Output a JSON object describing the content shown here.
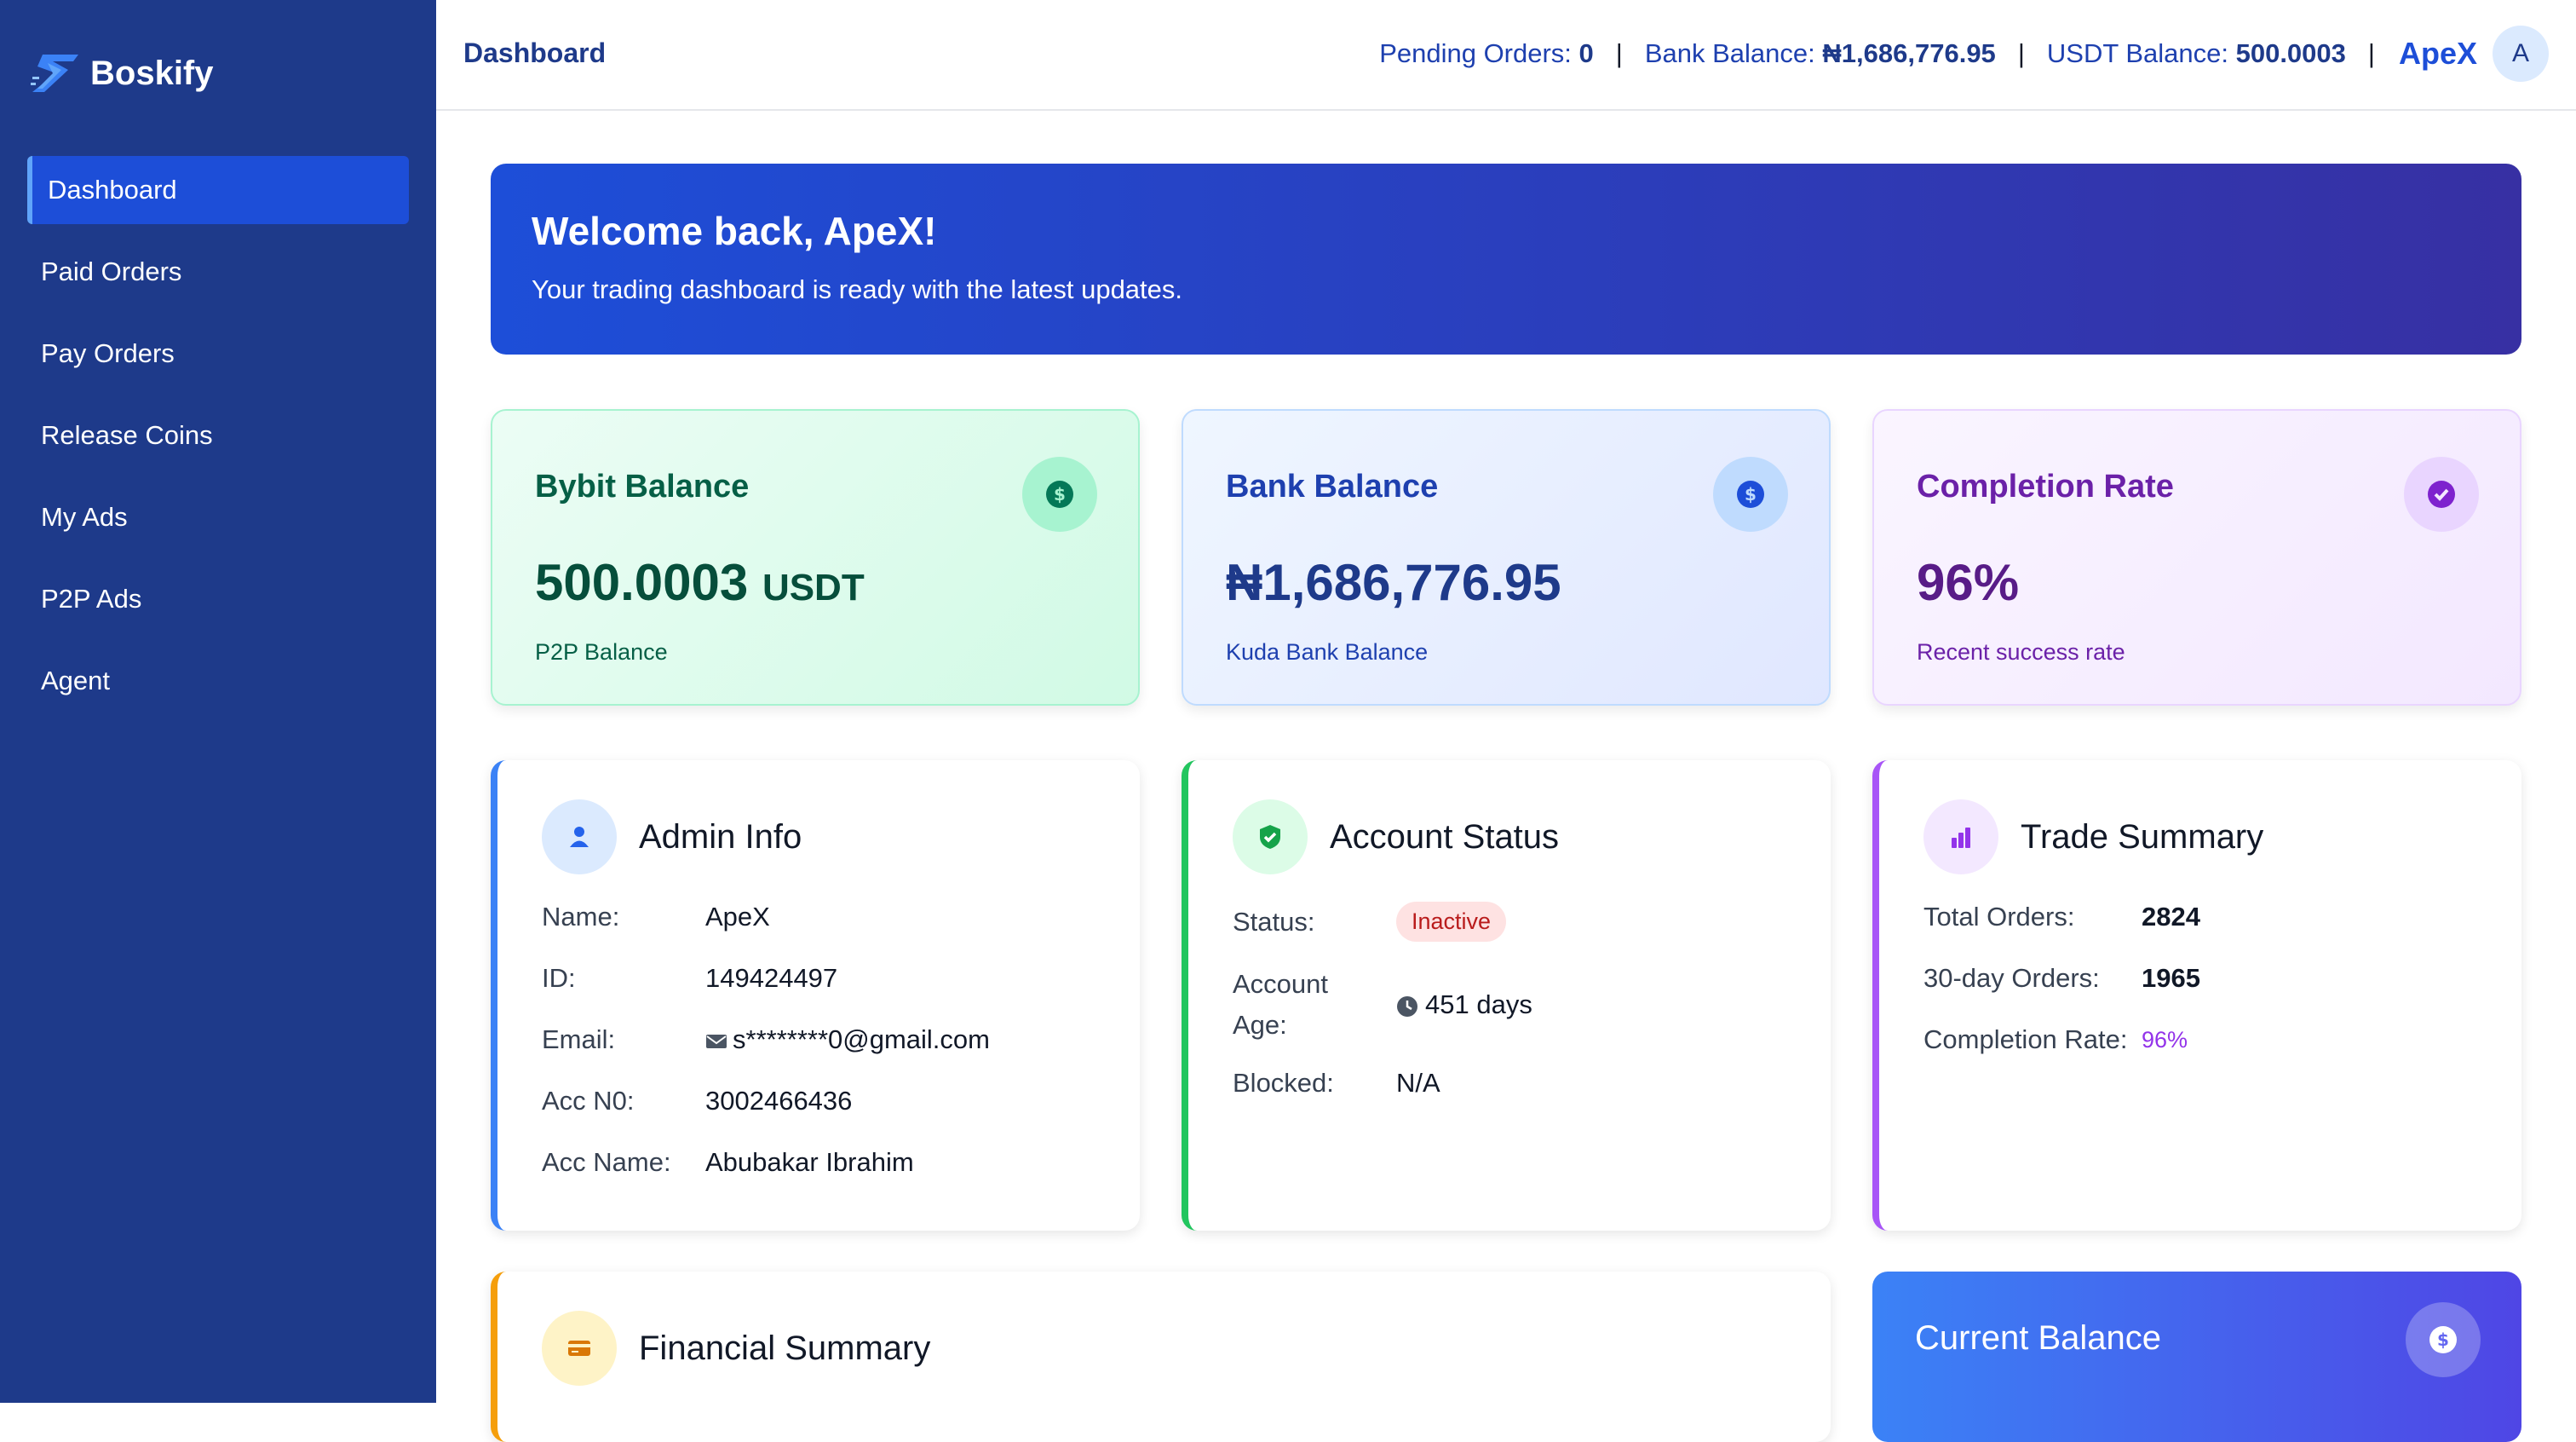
{
  "app": {
    "name": "Boskify"
  },
  "sidebar": {
    "items": [
      {
        "label": "Dashboard",
        "active": true
      },
      {
        "label": "Paid Orders"
      },
      {
        "label": "Pay Orders"
      },
      {
        "label": "Release Coins"
      },
      {
        "label": "My Ads"
      },
      {
        "label": "P2P Ads"
      },
      {
        "label": "Agent"
      }
    ]
  },
  "header": {
    "title": "Dashboard",
    "pending_label": "Pending Orders:",
    "pending_value": "0",
    "bank_label": "Bank Balance:",
    "bank_value": "₦1,686,776.95",
    "usdt_label": "USDT Balance:",
    "usdt_value": "500.0003",
    "separator": "|",
    "username": "ApeX",
    "avatar_initial": "A"
  },
  "welcome": {
    "title": "Welcome back, ApeX!",
    "subtitle": "Your trading dashboard is ready with the latest updates."
  },
  "stats": {
    "bybit": {
      "label": "Bybit Balance",
      "value": "500.0003",
      "unit": "USDT",
      "sub": "P2P Balance",
      "icon": "dollar-icon"
    },
    "bank": {
      "label": "Bank Balance",
      "value": "₦1,686,776.95",
      "sub": "Kuda Bank Balance",
      "icon": "dollar-icon"
    },
    "completion": {
      "label": "Completion Rate",
      "value": "96%",
      "sub": "Recent success rate",
      "icon": "check-circle-icon"
    }
  },
  "admin_info": {
    "title": "Admin Info",
    "icon": "user-icon",
    "name_label": "Name:",
    "name": "ApeX",
    "id_label": "ID:",
    "id": "149424497",
    "email_label": "Email:",
    "email": "s********0@gmail.com",
    "acc_no_label": "Acc N0:",
    "acc_no": "3002466436",
    "acc_name_label": "Acc Name:",
    "acc_name": "Abubakar Ibrahim"
  },
  "account_status": {
    "title": "Account Status",
    "icon": "shield-check-icon",
    "status_label": "Status:",
    "status": "Inactive",
    "age_label_1": "Account",
    "age_label_2": "Age:",
    "age": "451 days",
    "blocked_label": "Blocked:",
    "blocked": "N/A"
  },
  "trade_summary": {
    "title": "Trade Summary",
    "icon": "bar-chart-icon",
    "total_label": "Total Orders:",
    "total": "2824",
    "thirty_label": "30-day Orders:",
    "thirty": "1965",
    "rate_label": "Completion Rate:",
    "rate": "96%"
  },
  "financial_summary": {
    "title": "Financial Summary",
    "icon": "credit-card-icon"
  },
  "current_balance": {
    "title": "Current Balance",
    "icon": "dollar-icon"
  },
  "colors": {
    "sidebar": "#1e3a8a",
    "accent": "#1d4ed8",
    "green": "#10b981",
    "purple": "#a855f7",
    "orange": "#f59e0b",
    "blue": "#3b82f6"
  }
}
